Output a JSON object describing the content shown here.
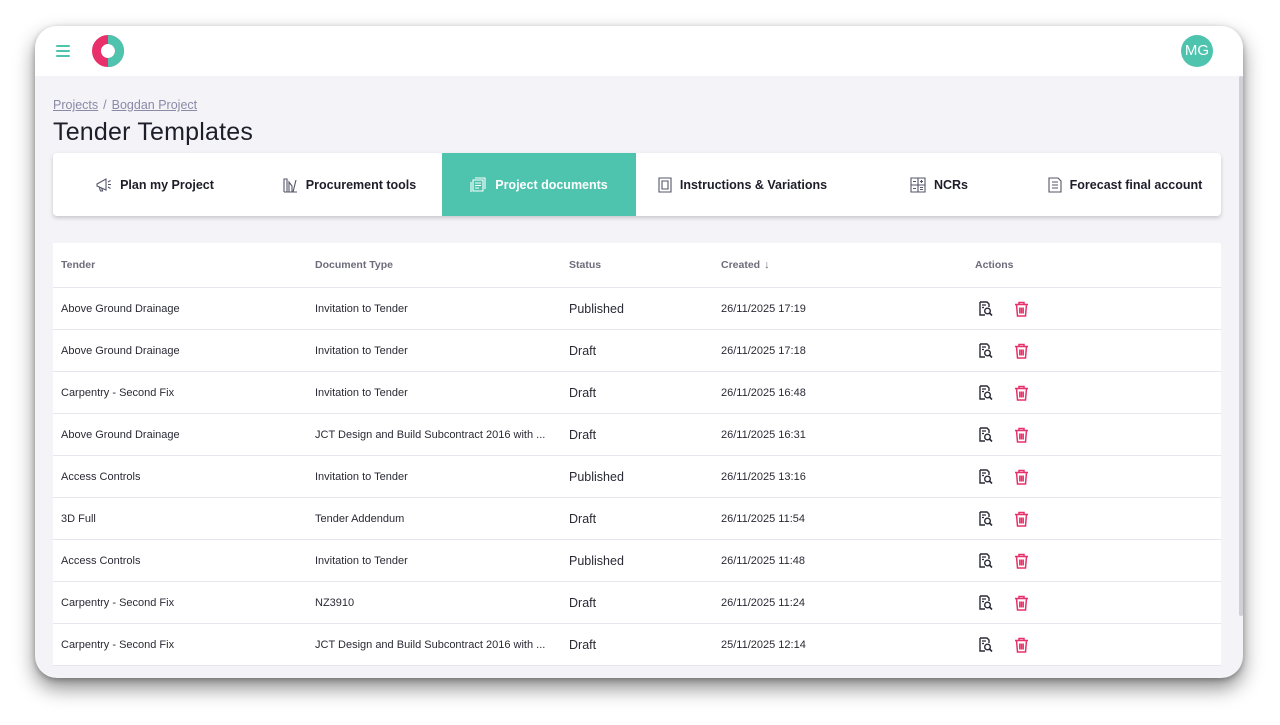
{
  "header": {
    "avatar_initials": "MG",
    "brand_colors": {
      "accent": "#4ec3ad",
      "logo_pink": "#e8306a"
    }
  },
  "breadcrumb": {
    "items": [
      "Projects",
      "Bogdan Project"
    ],
    "separator": "/"
  },
  "page_title": "Tender Templates",
  "tabs": [
    {
      "label": "Plan my Project",
      "icon": "megaphone-icon",
      "active": false
    },
    {
      "label": "Procurement tools",
      "icon": "tools-icon",
      "active": false
    },
    {
      "label": "Project documents",
      "icon": "documents-icon",
      "active": true
    },
    {
      "label": "Instructions & Variations",
      "icon": "instructions-icon",
      "active": false
    },
    {
      "label": "NCRs",
      "icon": "ncr-grid-icon",
      "active": false
    },
    {
      "label": "Forecast final account",
      "icon": "forecast-doc-icon",
      "active": false
    }
  ],
  "table": {
    "headers": {
      "tender": "Tender",
      "document_type": "Document Type",
      "status": "Status",
      "created": "Created",
      "actions": "Actions"
    },
    "sort_indicator": "↓",
    "rows": [
      {
        "tender": "Above Ground Drainage",
        "document_type": "Invitation to Tender",
        "status": "Published",
        "created": "26/11/2025 17:19"
      },
      {
        "tender": "Above Ground Drainage",
        "document_type": "Invitation to Tender",
        "status": "Draft",
        "created": "26/11/2025 17:18"
      },
      {
        "tender": "Carpentry - Second Fix",
        "document_type": "Invitation to Tender",
        "status": "Draft",
        "created": "26/11/2025 16:48"
      },
      {
        "tender": "Above Ground Drainage",
        "document_type": "JCT Design and Build Subcontract 2016 with ...",
        "status": "Draft",
        "created": "26/11/2025 16:31"
      },
      {
        "tender": "Access Controls",
        "document_type": "Invitation to Tender",
        "status": "Published",
        "created": "26/11/2025 13:16"
      },
      {
        "tender": "3D Full",
        "document_type": "Tender Addendum",
        "status": "Draft",
        "created": "26/11/2025 11:54"
      },
      {
        "tender": "Access Controls",
        "document_type": "Invitation to Tender",
        "status": "Published",
        "created": "26/11/2025 11:48"
      },
      {
        "tender": "Carpentry - Second Fix",
        "document_type": "NZ3910",
        "status": "Draft",
        "created": "26/11/2025 11:24"
      },
      {
        "tender": "Carpentry - Second Fix",
        "document_type": "JCT Design and Build Subcontract 2016 with ...",
        "status": "Draft",
        "created": "25/11/2025 12:14"
      }
    ]
  }
}
